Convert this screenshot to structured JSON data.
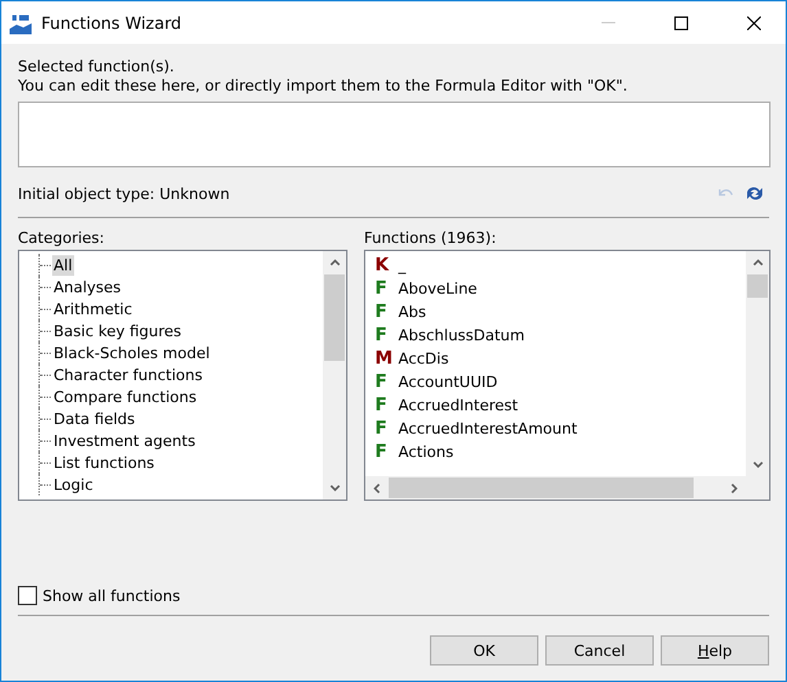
{
  "window": {
    "title": "Functions Wizard"
  },
  "intro": [
    "Selected function(s).",
    "You can edit these here, or directly import them to the Formula Editor with \"OK\"."
  ],
  "object_type": "Initial object type: Unknown",
  "undo": {
    "disabled": true
  },
  "categories": {
    "label": "Categories:",
    "items": [
      {
        "label": "All",
        "selected": true
      },
      {
        "label": "Analyses",
        "selected": false
      },
      {
        "label": "Arithmetic",
        "selected": false
      },
      {
        "label": "Basic key figures",
        "selected": false
      },
      {
        "label": "Black-Scholes model",
        "selected": false
      },
      {
        "label": "Character functions",
        "selected": false
      },
      {
        "label": "Compare functions",
        "selected": false
      },
      {
        "label": "Data fields",
        "selected": false
      },
      {
        "label": "Investment agents",
        "selected": false
      },
      {
        "label": "List functions",
        "selected": false
      },
      {
        "label": "Logic",
        "selected": false
      }
    ]
  },
  "functions": {
    "label": "Functions (1963):",
    "items": [
      {
        "kind": "constant",
        "badge": "K",
        "name": "_"
      },
      {
        "kind": "function",
        "badge": "F",
        "name": "AboveLine"
      },
      {
        "kind": "function",
        "badge": "F",
        "name": "Abs"
      },
      {
        "kind": "function",
        "badge": "F",
        "name": "AbschlussDatum"
      },
      {
        "kind": "macro",
        "badge": "M",
        "name": "AccDis"
      },
      {
        "kind": "function",
        "badge": "F",
        "name": "AccountUUID"
      },
      {
        "kind": "function",
        "badge": "F",
        "name": "AccruedInterest"
      },
      {
        "kind": "function",
        "badge": "F",
        "name": "AccruedInterestAmount"
      },
      {
        "kind": "function",
        "badge": "F",
        "name": "Actions"
      }
    ]
  },
  "show_all": {
    "label": "Show all functions",
    "checked": false
  },
  "buttons": [
    {
      "label": "OK",
      "mnemonic": false
    },
    {
      "label": "Cancel",
      "mnemonic": false
    },
    {
      "label": "Help",
      "mnemonic": true
    }
  ]
}
